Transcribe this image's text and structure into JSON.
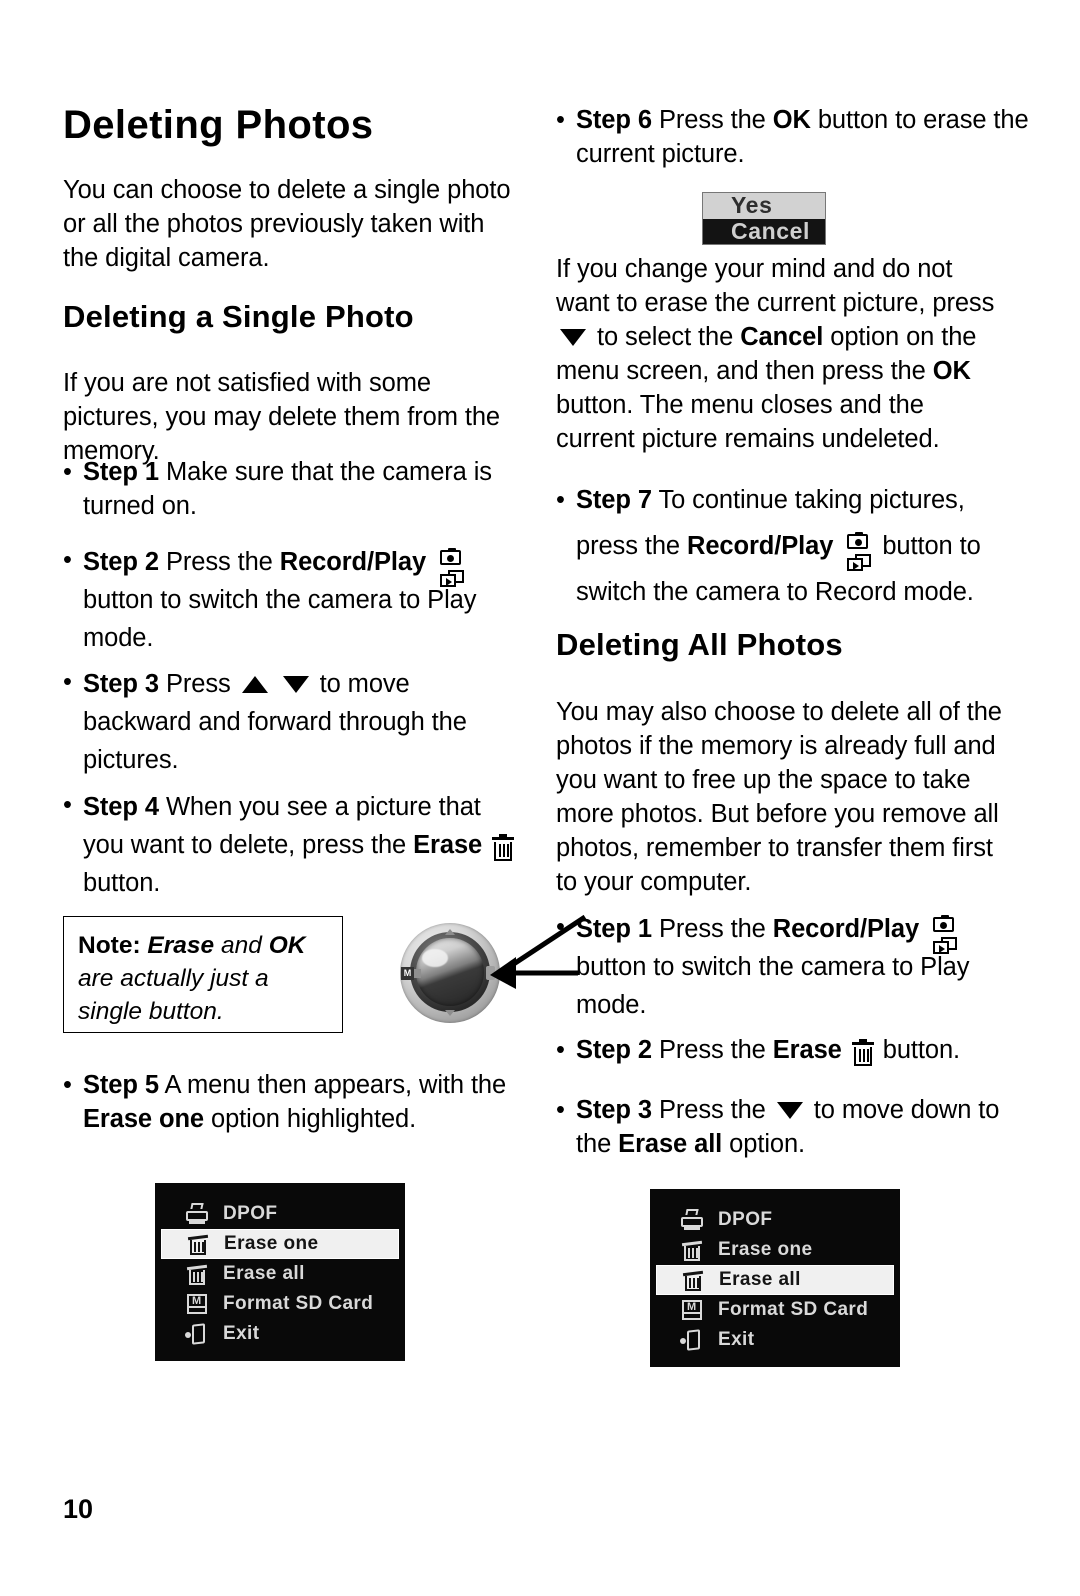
{
  "page": {
    "number": "10"
  },
  "left_column": {
    "title": "Deleting Photos",
    "intro": "You can choose to delete a single photo or all the photos previously taken with the digital camera.",
    "subtitle": "Deleting a Single Photo",
    "subtitle_body": "If you are not satisfied with some pictures, you may delete them from the memory.",
    "steps": [
      {
        "label": "Step 1",
        "text_before": "Make sure that the camera is turned on.",
        "text_after": ""
      },
      {
        "label": "Step 2",
        "pre": "Press the",
        "bold_term": "Record/Play",
        "icon": "record-play-icon",
        "post": "button  to switch the camera to Play mode."
      },
      {
        "label": "Step 3",
        "pre": "Press",
        "icon_up": "triangle-up-icon",
        "icon_down": "triangle-down-icon",
        "post": "to move backward and forward through the pictures."
      },
      {
        "label": "Step 4",
        "pre": "When you see a picture that you want to delete, press the",
        "bold_term": "Erase",
        "icon": "trash-icon",
        "post": "button."
      },
      {
        "label": "Step 5",
        "pre": "A menu then appears, with the",
        "bold_term": "Erase one",
        "post": "option highlighted."
      }
    ],
    "note": {
      "label": "Note:",
      "term_one": "Erase",
      "mid": "and",
      "term_two": "OK",
      "tail": "are actually just a single button."
    },
    "dial_photo": {
      "name": "camera-navigation-dial-photo",
      "mode_badge": "M"
    },
    "menu_screenshot": {
      "name": "lcd-menu-erase-one",
      "items": [
        {
          "icon": "dpof-printer-icon",
          "label": "DPOF",
          "selected": false
        },
        {
          "icon": "trash-icon",
          "label": "Erase one",
          "selected": true
        },
        {
          "icon": "trash-icon",
          "label": "Erase all",
          "selected": false
        },
        {
          "icon": "sd-card-icon",
          "label": "Format SD Card",
          "selected": false
        },
        {
          "icon": "exit-door-icon",
          "label": "Exit",
          "selected": false
        }
      ]
    }
  },
  "right_column": {
    "step6": {
      "label": "Step 6",
      "pre": "Press the",
      "bold_term": "OK",
      "post": "button to erase the current picture."
    },
    "dialog": {
      "name": "yes-cancel-dialog",
      "yes": "Yes",
      "cancel": "Cancel"
    },
    "cancel_paragraph": {
      "p1": "If you change your mind and do not want to erase the current picture, press",
      "icon_down": "triangle-down-icon",
      "p2": "to select the",
      "bold_cancel": "Cancel",
      "p3": "option on the menu screen, and then press the",
      "bold_ok": "OK",
      "p4": "button. The menu closes and the current picture remains undeleted."
    },
    "step7": {
      "label": "Step 7",
      "pre": "To continue taking pictures,",
      "mid": "press the",
      "bold_term": "Record/Play",
      "icon": "record-play-icon",
      "post": "button to switch the camera to Record mode."
    },
    "subtitle": "Deleting All Photos",
    "subtitle_body": "You may also choose to delete all of the photos if the memory is already full and you want to free up the space to take more photos. But before you remove all photos, remember to transfer them first to your computer.",
    "steps": [
      {
        "label": "Step 1",
        "pre": "Press the",
        "bold_term": "Record/Play",
        "icon": "record-play-icon",
        "post": "button  to switch the camera to Play mode."
      },
      {
        "label": "Step 2",
        "pre": "Press the",
        "bold_term": "Erase",
        "icon": "trash-icon",
        "post": "button."
      },
      {
        "label": "Step 3",
        "pre": "Press the",
        "icon_down": "triangle-down-icon",
        "post": "to move down to the",
        "bold_term2": "Erase all",
        "post2": "option."
      }
    ],
    "menu_screenshot": {
      "name": "lcd-menu-erase-all",
      "items": [
        {
          "icon": "dpof-printer-icon",
          "label": "DPOF",
          "selected": false
        },
        {
          "icon": "trash-icon",
          "label": "Erase one",
          "selected": false
        },
        {
          "icon": "trash-icon",
          "label": "Erase all",
          "selected": true
        },
        {
          "icon": "sd-card-icon",
          "label": "Format SD Card",
          "selected": false
        },
        {
          "icon": "exit-door-icon",
          "label": "Exit",
          "selected": false
        }
      ]
    }
  }
}
